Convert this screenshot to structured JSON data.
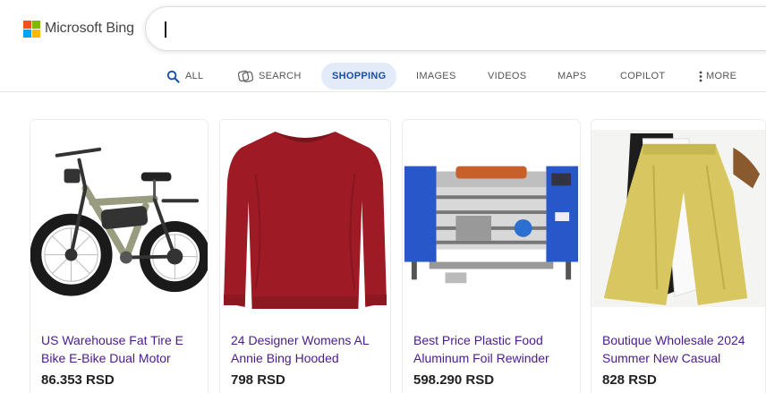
{
  "logo": {
    "text": "Microsoft Bing",
    "colors": [
      "#f25022",
      "#7fba00",
      "#00a4ef",
      "#ffb900"
    ]
  },
  "search": {
    "value": ""
  },
  "tabs": [
    {
      "label": "ALL",
      "icon": "search-icon"
    },
    {
      "label": "SEARCH",
      "icon": "copilot-search-icon"
    },
    {
      "label": "SHOPPING",
      "icon": "",
      "active": true
    },
    {
      "label": "IMAGES",
      "icon": ""
    },
    {
      "label": "VIDEOS",
      "icon": ""
    },
    {
      "label": "MAPS",
      "icon": ""
    },
    {
      "label": "COPILOT",
      "icon": ""
    },
    {
      "label": "MORE",
      "icon": "more-vertical-icon"
    }
  ],
  "products": [
    {
      "title": "US Warehouse Fat Tire E Bike E-Bike Dual Motor",
      "price": "86.353 RSD",
      "image": "electric-bike-image"
    },
    {
      "title": "24 Designer Womens AL Annie Bing Hooded",
      "price": "798 RSD",
      "image": "red-sweatshirt-image"
    },
    {
      "title": "Best Price Plastic Food Aluminum Foil Rewinder",
      "price": "598.290 RSD",
      "image": "foil-rewinder-machine-image"
    },
    {
      "title": "Boutique Wholesale 2024 Summer New Casual",
      "price": "828 RSD",
      "image": "wide-leg-pants-image"
    }
  ],
  "colors": {
    "accent": "#174ea6",
    "active_tab_bg": "#e3ebf8",
    "link": "#4b1b8c"
  }
}
